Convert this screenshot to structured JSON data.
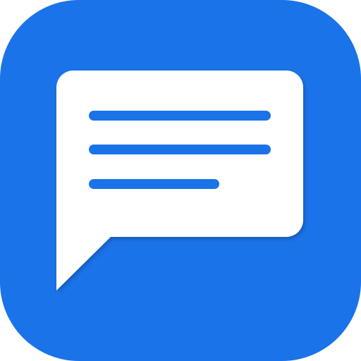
{
  "app_icon": {
    "icon": "chat-message-icon",
    "background_color": "#1A73E8",
    "bubble_color": "#FFFFFF",
    "line_color": "#1A73E8",
    "text_lines": 3
  }
}
